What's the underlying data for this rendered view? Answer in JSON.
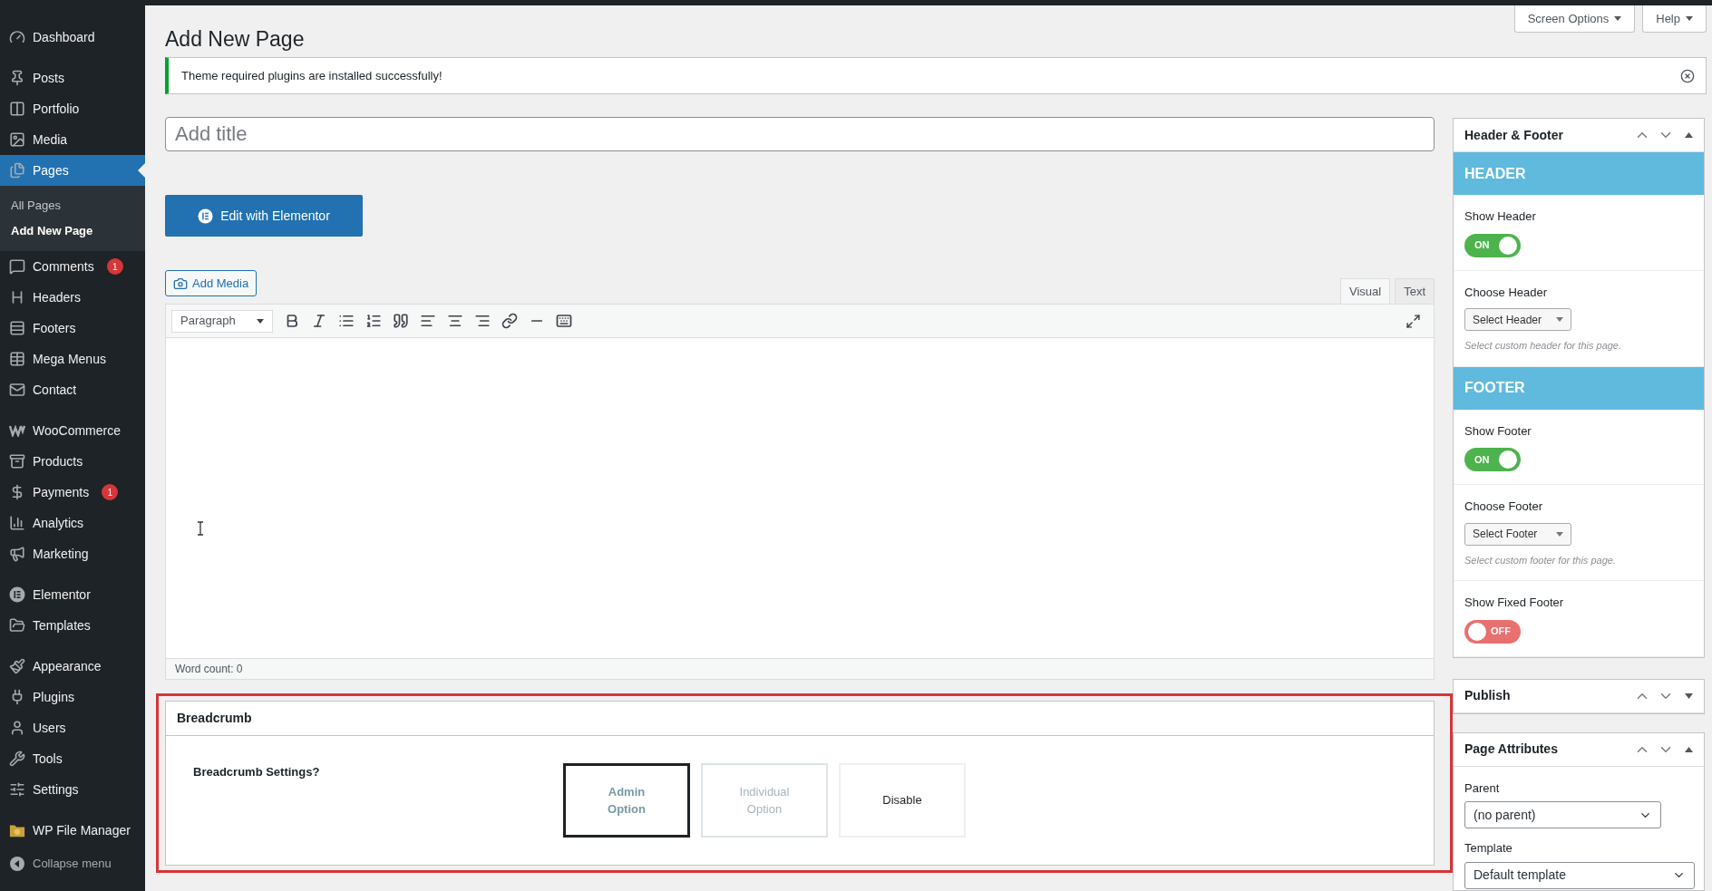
{
  "sidebar": {
    "groups": [
      [
        {
          "label": "Dashboard",
          "selected": false
        }
      ],
      [
        {
          "label": "Posts",
          "selected": false
        },
        {
          "label": "Portfolio",
          "selected": false
        },
        {
          "label": "Media",
          "selected": false
        },
        {
          "label": "Pages",
          "selected": true,
          "submenu": [
            {
              "label": "All Pages",
              "selected": false
            },
            {
              "label": "Add New Page",
              "selected": true
            }
          ]
        },
        {
          "label": "Comments",
          "selected": false,
          "badge": "1"
        },
        {
          "label": "Headers",
          "selected": false
        },
        {
          "label": "Footers",
          "selected": false
        },
        {
          "label": "Mega Menus",
          "selected": false
        },
        {
          "label": "Contact",
          "selected": false
        }
      ],
      [
        {
          "label": "WooCommerce",
          "selected": false
        },
        {
          "label": "Products",
          "selected": false
        },
        {
          "label": "Payments",
          "selected": false,
          "badge": "1"
        },
        {
          "label": "Analytics",
          "selected": false
        },
        {
          "label": "Marketing",
          "selected": false
        }
      ],
      [
        {
          "label": "Elementor",
          "selected": false
        },
        {
          "label": "Templates",
          "selected": false
        }
      ],
      [
        {
          "label": "Appearance",
          "selected": false
        },
        {
          "label": "Plugins",
          "selected": false
        },
        {
          "label": "Users",
          "selected": false
        },
        {
          "label": "Tools",
          "selected": false
        },
        {
          "label": "Settings",
          "selected": false
        }
      ],
      [
        {
          "label": "WP File Manager",
          "selected": false
        }
      ]
    ],
    "collapse": "Collapse menu"
  },
  "top_buttons": [
    "Screen Options",
    "Help"
  ],
  "page_title": "Add New Page",
  "notice": "Theme required plugins are installed successfully!",
  "title_field": {
    "placeholder": "Add title"
  },
  "elementor_button": "Edit with Elementor",
  "add_media": "Add Media",
  "editor_tabs": [
    {
      "label": "Visual",
      "selected": true
    },
    {
      "label": "Text",
      "selected": false
    }
  ],
  "format_select": "Paragraph",
  "word_count": "Word count: 0",
  "breadcrumb": {
    "title": "Breadcrumb",
    "question": "Breadcrumb Settings?",
    "options": [
      {
        "label": "Admin Option",
        "selected": true,
        "disabled": false
      },
      {
        "label": "Individual Option",
        "selected": false,
        "disabled": true
      },
      {
        "label": "Disable",
        "selected": false,
        "disabled": false
      }
    ]
  },
  "header_footer": {
    "title": "Header & Footer",
    "sections": [
      {
        "kind": "band",
        "label": "HEADER"
      },
      {
        "kind": "toggle",
        "label": "Show Header",
        "on": true,
        "text": "ON"
      },
      {
        "kind": "select",
        "label": "Choose Header",
        "value": "Select Header",
        "hint": "Select custom header for this page."
      },
      {
        "kind": "band",
        "label": "FOOTER"
      },
      {
        "kind": "toggle",
        "label": "Show Footer",
        "on": true,
        "text": "ON"
      },
      {
        "kind": "select",
        "label": "Choose Footer",
        "value": "Select Footer",
        "hint": "Select custom footer for this page."
      },
      {
        "kind": "toggle",
        "label": "Show Fixed Footer",
        "on": false,
        "text": "OFF"
      }
    ]
  },
  "publish": {
    "title": "Publish",
    "expanded": false
  },
  "page_attributes": {
    "title": "Page Attributes",
    "expanded": true,
    "parent_label": "Parent",
    "parent_value": "(no parent)",
    "template_label": "Template",
    "template_value": "Default template"
  }
}
